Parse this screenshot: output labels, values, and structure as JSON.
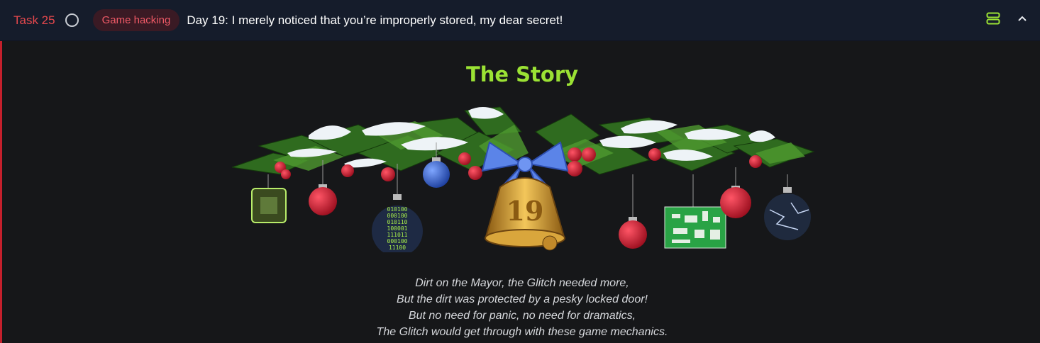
{
  "header": {
    "task_label": "Task 25",
    "tag": "Game hacking",
    "title": "Day 19: I merely noticed that you’re improperly stored, my dear secret!",
    "icons": [
      "status-circle-icon",
      "server-icon",
      "chevron-up-icon"
    ]
  },
  "content": {
    "heading": "The Story",
    "garland_number": "19",
    "poem": [
      "Dirt on the Mayor, the Glitch needed more,",
      "But the dirt was protected by a pesky locked door!",
      "But no need for panic, no need for dramatics,",
      "The Glitch would get through with these game mechanics."
    ],
    "binary_rows": [
      "010100",
      "000100",
      "010110",
      "100001",
      "111011",
      "000100",
      "11100"
    ]
  },
  "colors": {
    "header_bg": "#151c2b",
    "accent_red": "#e5484d",
    "heading_green": "#9be234",
    "page_bg": "#161719"
  }
}
